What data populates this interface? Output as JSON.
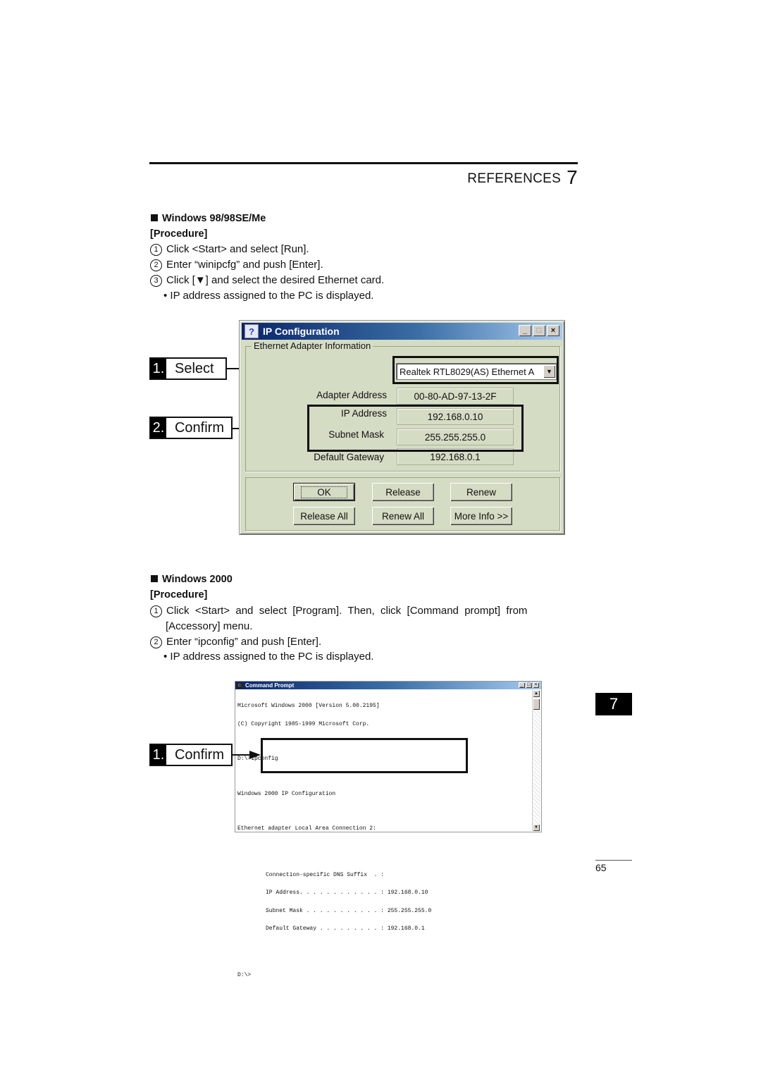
{
  "header": {
    "section_title": "REFERENCES",
    "chapter_number": "7"
  },
  "win98_section": {
    "heading": "Windows 98/98SE/Me",
    "procedure_label": "[Procedure]",
    "steps": [
      {
        "num": "1",
        "text": "Click <Start> and select [Run]."
      },
      {
        "num": "2",
        "text": "Enter “winipcfg” and push [Enter]."
      },
      {
        "num": "3",
        "text": "Click [▼] and select the desired Ethernet card."
      }
    ],
    "note": "• IP address assigned to the PC is displayed.",
    "callouts": [
      {
        "num": "1.",
        "label": "Select"
      },
      {
        "num": "2.",
        "label": "Confirm"
      }
    ],
    "window": {
      "title": "IP Configuration",
      "group_label": "Ethernet  Adapter Information",
      "adapter_select_value": "Realtek RTL8029(AS) Ethernet A",
      "fields": [
        {
          "label": "Adapter Address",
          "value": "00-80-AD-97-13-2F"
        },
        {
          "label": "IP Address",
          "value": "192.168.0.10"
        },
        {
          "label": "Subnet Mask",
          "value": "255.255.255.0"
        },
        {
          "label": "Default Gateway",
          "value": "192.168.0.1"
        }
      ],
      "buttons": {
        "ok": "OK",
        "release": "Release",
        "renew": "Renew",
        "release_all": "Release All",
        "renew_all": "Renew All",
        "more_info": "More Info >>"
      },
      "title_buttons": {
        "minimize": "_",
        "maximize": "□",
        "close": "×"
      }
    }
  },
  "win2000_section": {
    "heading": "Windows 2000",
    "procedure_label": "[Procedure]",
    "steps": [
      {
        "num": "1",
        "text_line1": "Click  <Start>  and  select  [Program].  Then,  click  [Command  prompt]  from",
        "text_line2": "[Accessory] menu."
      },
      {
        "num": "2",
        "text": "Enter “ipconfig” and push [Enter]."
      }
    ],
    "note": "• IP address assigned to the PC is displayed.",
    "callouts": [
      {
        "num": "1.",
        "label": "Confirm"
      }
    ],
    "window": {
      "title": "Command Prompt",
      "lines_top": [
        "Microsoft Windows 2000 [Version 5.00.2195]",
        "(C) Copyright 1985-1999 Microsoft Corp.",
        "",
        "D:\\>ipconfig",
        "",
        "Windows 2000 IP Configuration",
        "",
        "Ethernet adapter Local Area Connection 2:",
        ""
      ],
      "lines_box": [
        "Connection-specific DNS Suffix  . :",
        "IP Address. . . . . . . . . . . . : 192.168.0.10",
        "Subnet Mask . . . . . . . . . . . : 255.255.255.0",
        "Default Gateway . . . . . . . . . : 192.168.0.1"
      ],
      "prompt": "D:\\>",
      "title_buttons": {
        "minimize": "_",
        "maximize": "□",
        "close": "×"
      },
      "scroll_up": "▲",
      "scroll_down": "▼"
    }
  },
  "side_tab": "7",
  "page_number": "65"
}
